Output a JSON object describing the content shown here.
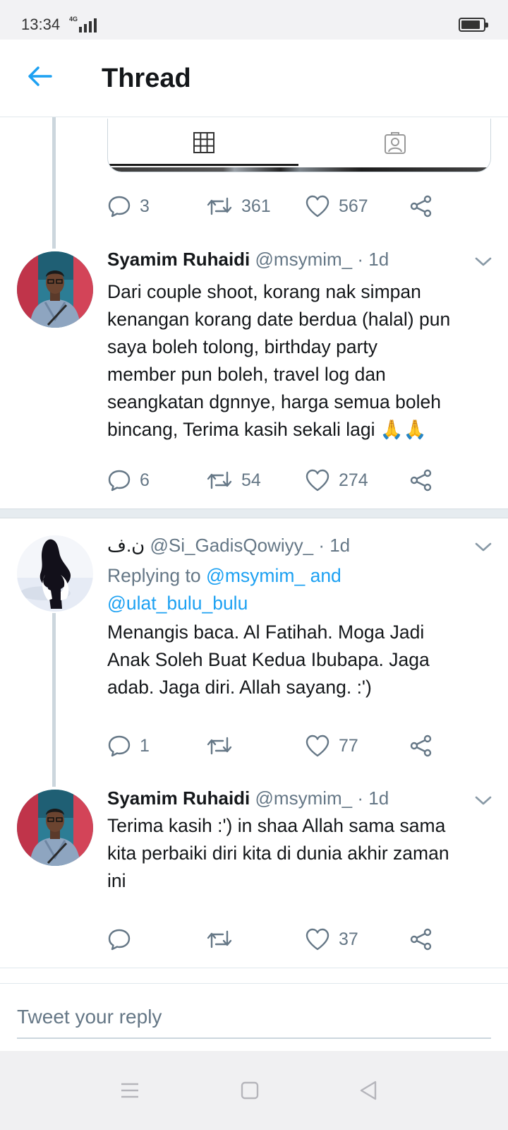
{
  "status_bar": {
    "time": "13:34",
    "network": "4G"
  },
  "header": {
    "title": "Thread"
  },
  "top_tweet": {
    "actions": {
      "replies": "3",
      "retweets": "361",
      "likes": "567"
    }
  },
  "tweets": [
    {
      "name": "Syamim Ruhaidi",
      "handle": "@msymim_",
      "time": "· 1d",
      "lines": [
        "Dari couple shoot, korang nak simpan",
        "kenangan korang date berdua (halal) pun",
        "saya boleh tolong, birthday party",
        "member pun boleh, travel log dan",
        "seangkatan dgnnye, harga semua boleh",
        "bincang, Terima kasih sekali lagi 🙏🙏"
      ],
      "actions": {
        "replies": "6",
        "retweets": "54",
        "likes": "274"
      }
    },
    {
      "name": "ن.ف",
      "handle": "@Si_GadisQowiyy_",
      "time": "· 1d",
      "replying_prefix": "Replying to ",
      "replying_user1": "@msymim_",
      "replying_and": " and",
      "replying_user2": "@ulat_bulu_bulu",
      "lines": [
        "Menangis baca. Al Fatihah. Moga Jadi",
        "Anak Soleh Buat Kedua Ibubapa. Jaga",
        "adab. Jaga diri. Allah sayang. :')"
      ],
      "actions": {
        "replies": "1",
        "retweets": "",
        "likes": "77"
      }
    },
    {
      "name": "Syamim Ruhaidi",
      "handle": "@msymim_",
      "time": "· 1d",
      "lines": [
        "Terima kasih :') in shaa Allah sama sama",
        "kita perbaiki diri kita di dunia akhir zaman",
        "ini"
      ],
      "actions": {
        "replies": "",
        "retweets": "",
        "likes": "37"
      }
    }
  ],
  "composer": {
    "placeholder": "Tweet your reply"
  },
  "colors": {
    "accent": "#1da1f2",
    "muted": "#657786",
    "text": "#14171a"
  },
  "icons": [
    "back-arrow-icon",
    "grid-icon",
    "portrait-icon",
    "reply-icon",
    "retweet-icon",
    "like-icon",
    "share-icon",
    "chevron-down-icon",
    "menu-icon",
    "home-square-icon",
    "back-triangle-icon"
  ]
}
